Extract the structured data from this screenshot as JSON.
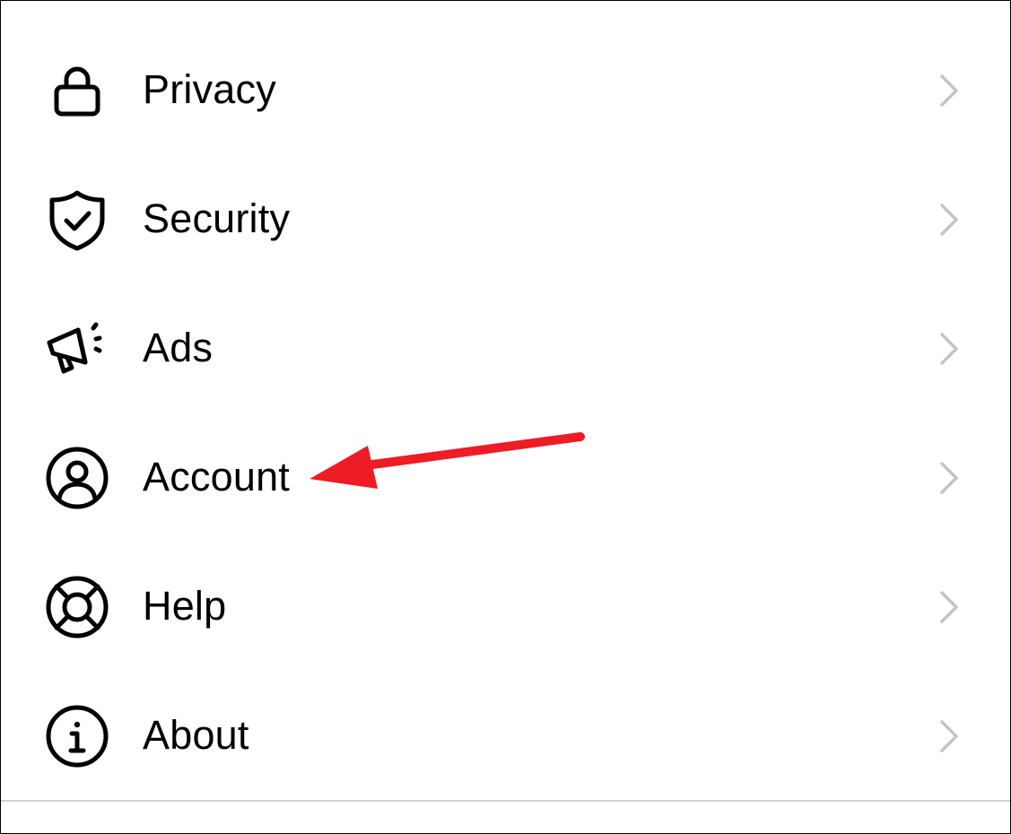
{
  "menu": {
    "items": [
      {
        "label": "Privacy",
        "icon": "lock-icon"
      },
      {
        "label": "Security",
        "icon": "shield-check-icon"
      },
      {
        "label": "Ads",
        "icon": "megaphone-icon"
      },
      {
        "label": "Account",
        "icon": "user-circle-icon"
      },
      {
        "label": "Help",
        "icon": "lifebuoy-icon"
      },
      {
        "label": "About",
        "icon": "info-icon"
      }
    ],
    "chevron_icon": "chevron-right-icon"
  },
  "annotation": {
    "type": "arrow",
    "color": "#ee1c25",
    "points_to": "Account"
  },
  "colors": {
    "background": "#ffffff",
    "text": "#000000",
    "chevron": "#c4c4c4",
    "divider": "#d1d1d1"
  }
}
